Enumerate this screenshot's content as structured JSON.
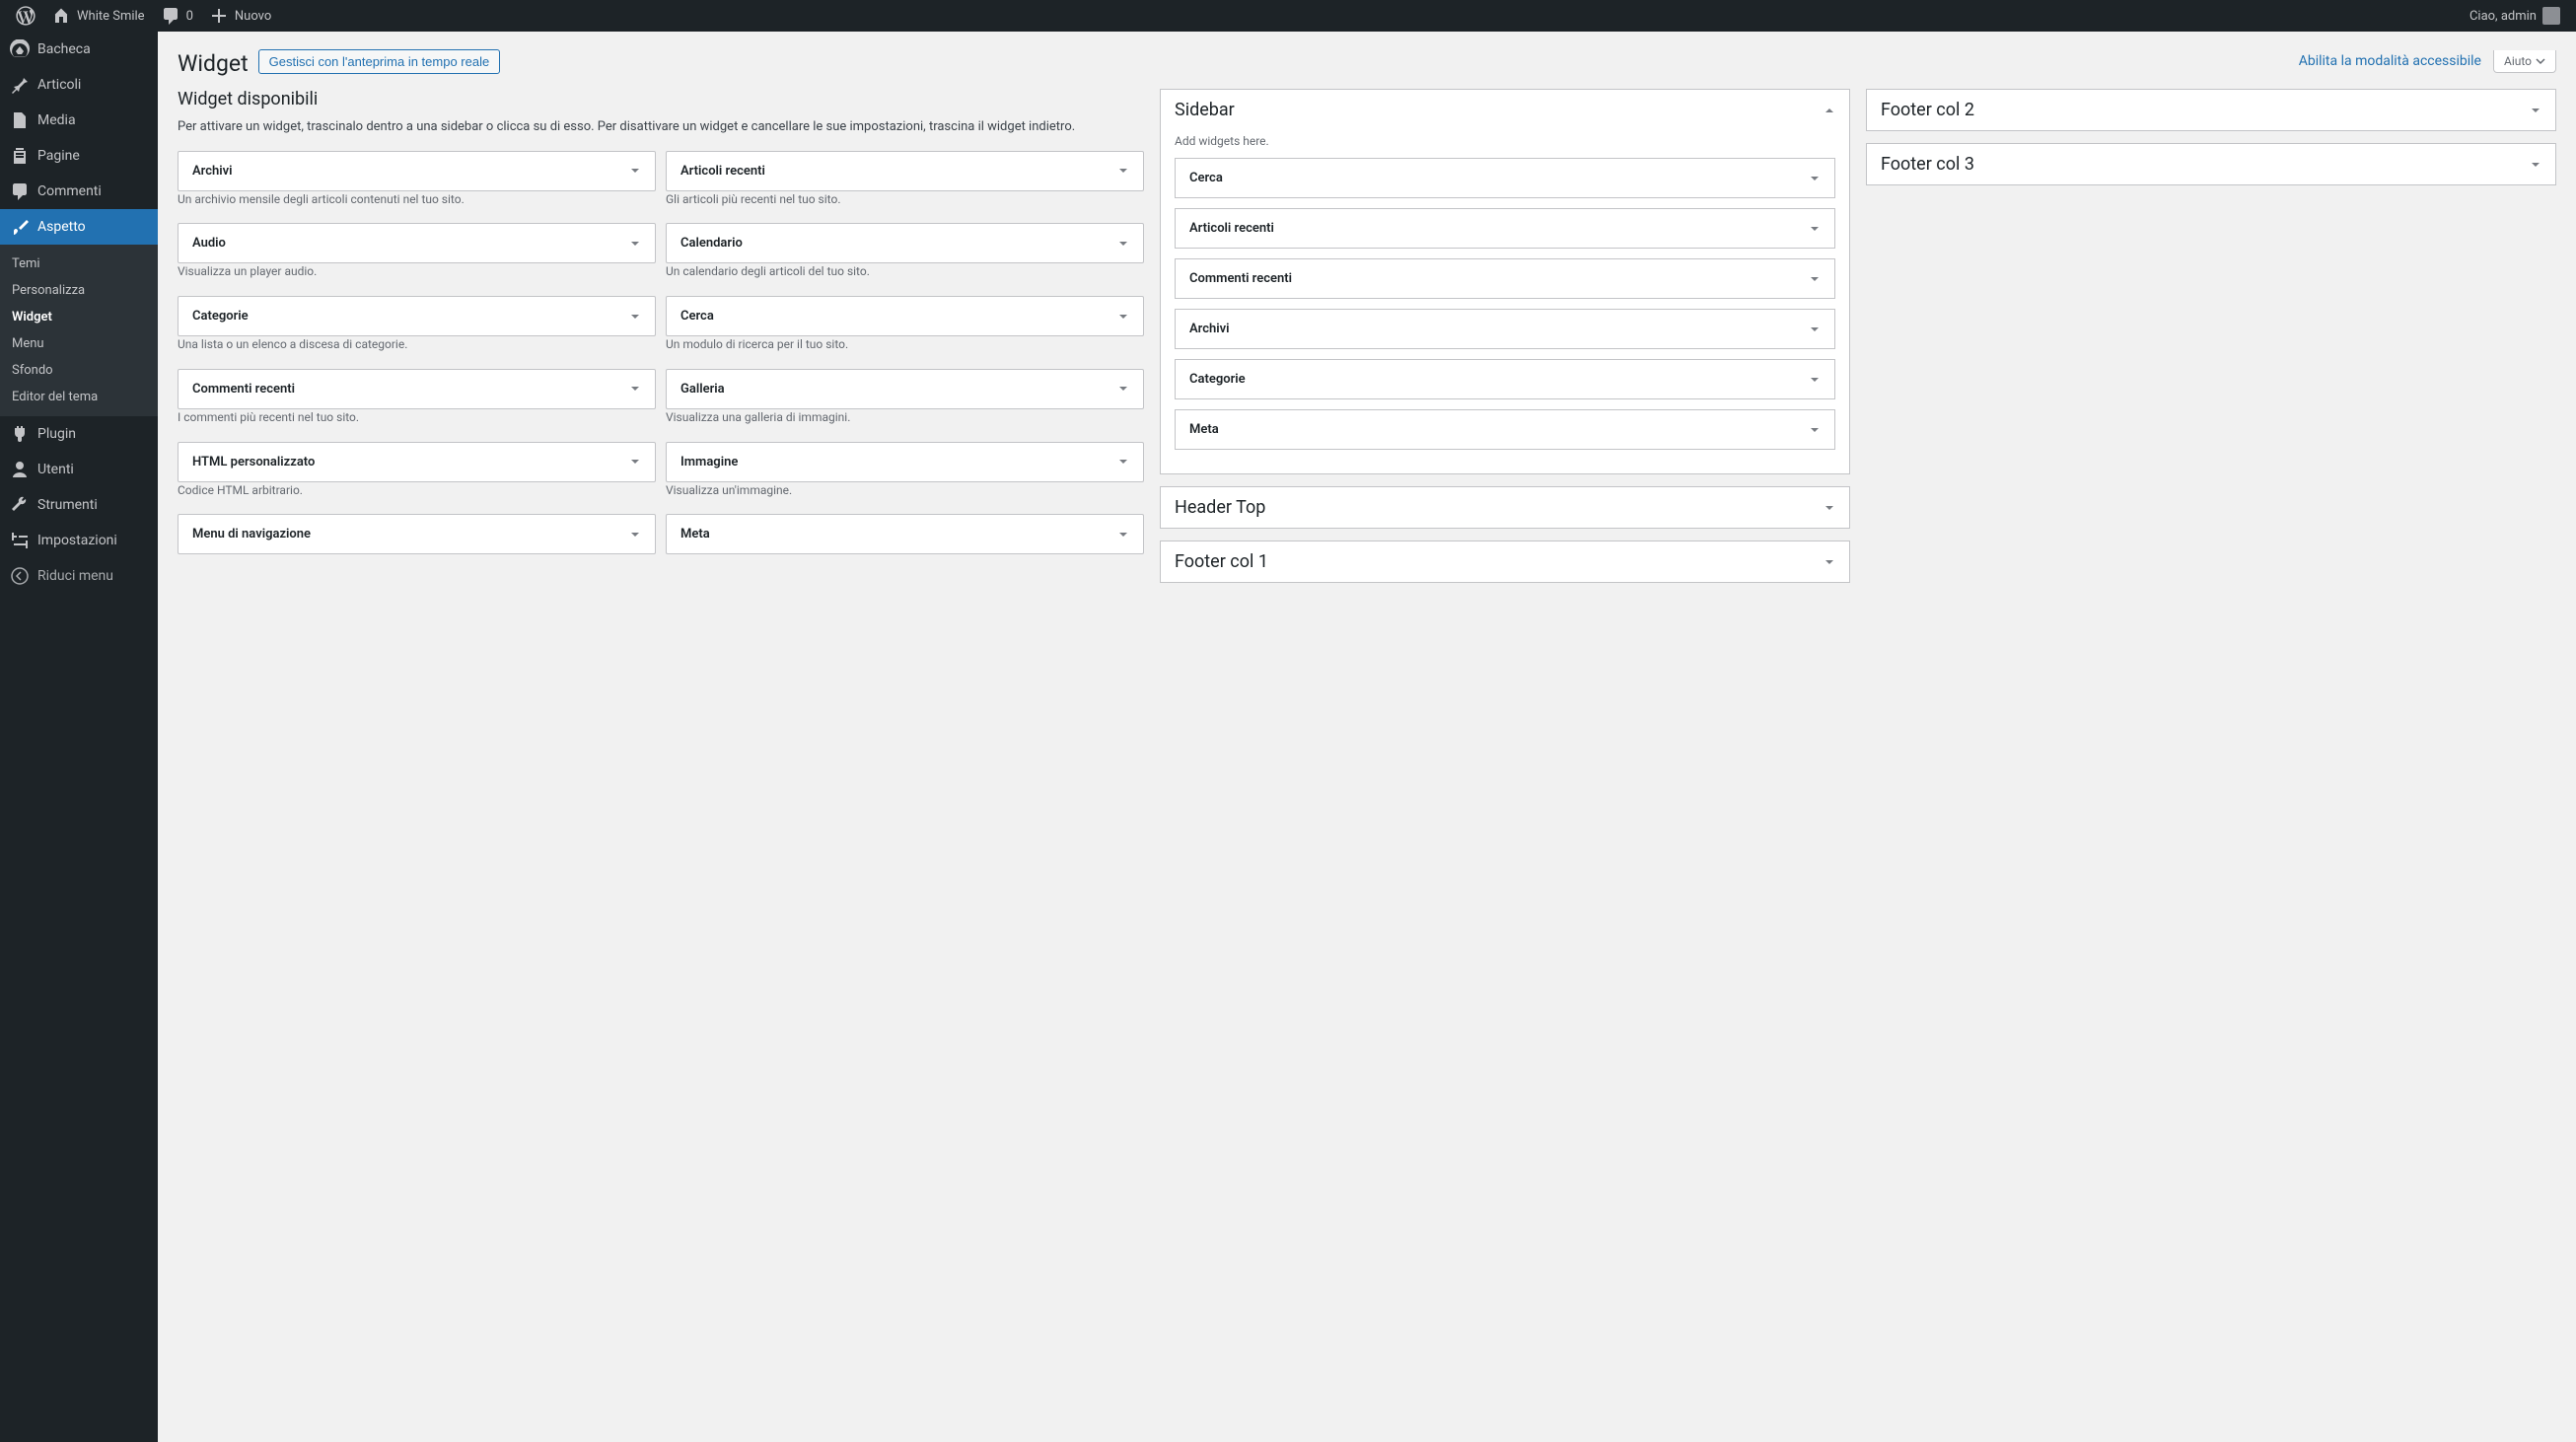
{
  "adminbar": {
    "site_name": "White Smile",
    "comments_count": "0",
    "new_label": "Nuovo",
    "greeting": "Ciao, admin"
  },
  "menu": {
    "dashboard": "Bacheca",
    "posts": "Articoli",
    "media": "Media",
    "pages": "Pagine",
    "comments": "Commenti",
    "appearance": "Aspetto",
    "appearance_sub": {
      "themes": "Temi",
      "customize": "Personalizza",
      "widgets": "Widget",
      "menus": "Menu",
      "background": "Sfondo",
      "editor": "Editor del tema"
    },
    "plugins": "Plugin",
    "users": "Utenti",
    "tools": "Strumenti",
    "settings": "Impostazioni",
    "collapse": "Riduci menu"
  },
  "page": {
    "title": "Widget",
    "manage_preview": "Gestisci con l'anteprima in tempo reale",
    "enable_accessibility": "Abilita la modalità accessibile",
    "help": "Aiuto"
  },
  "available": {
    "title": "Widget disponibili",
    "desc": "Per attivare un widget, trascinalo dentro a una sidebar o clicca su di esso. Per disattivare un widget e cancellare le sue impostazioni, trascina il widget indietro.",
    "widgets_left": [
      {
        "name": "Archivi",
        "desc": "Un archivio mensile degli articoli contenuti nel tuo sito."
      },
      {
        "name": "Audio",
        "desc": "Visualizza un player audio."
      },
      {
        "name": "Categorie",
        "desc": "Una lista o un elenco a discesa di categorie."
      },
      {
        "name": "Commenti recenti",
        "desc": "I commenti più recenti nel tuo sito."
      },
      {
        "name": "HTML personalizzato",
        "desc": "Codice HTML arbitrario."
      },
      {
        "name": "Menu di navigazione",
        "desc": ""
      }
    ],
    "widgets_right": [
      {
        "name": "Articoli recenti",
        "desc": "Gli articoli più recenti nel tuo sito."
      },
      {
        "name": "Calendario",
        "desc": "Un calendario degli articoli del tuo sito."
      },
      {
        "name": "Cerca",
        "desc": "Un modulo di ricerca per il tuo sito."
      },
      {
        "name": "Galleria",
        "desc": "Visualizza una galleria di immagini."
      },
      {
        "name": "Immagine",
        "desc": "Visualizza un'immagine."
      },
      {
        "name": "Meta",
        "desc": ""
      }
    ]
  },
  "areas_col1": [
    {
      "title": "Sidebar",
      "open": true,
      "desc": "Add widgets here.",
      "widgets": [
        "Cerca",
        "Articoli recenti",
        "Commenti recenti",
        "Archivi",
        "Categorie",
        "Meta"
      ]
    },
    {
      "title": "Header Top",
      "open": false
    },
    {
      "title": "Footer col 1",
      "open": false
    }
  ],
  "areas_col2": [
    {
      "title": "Footer col 2",
      "open": false
    },
    {
      "title": "Footer col 3",
      "open": false
    }
  ]
}
